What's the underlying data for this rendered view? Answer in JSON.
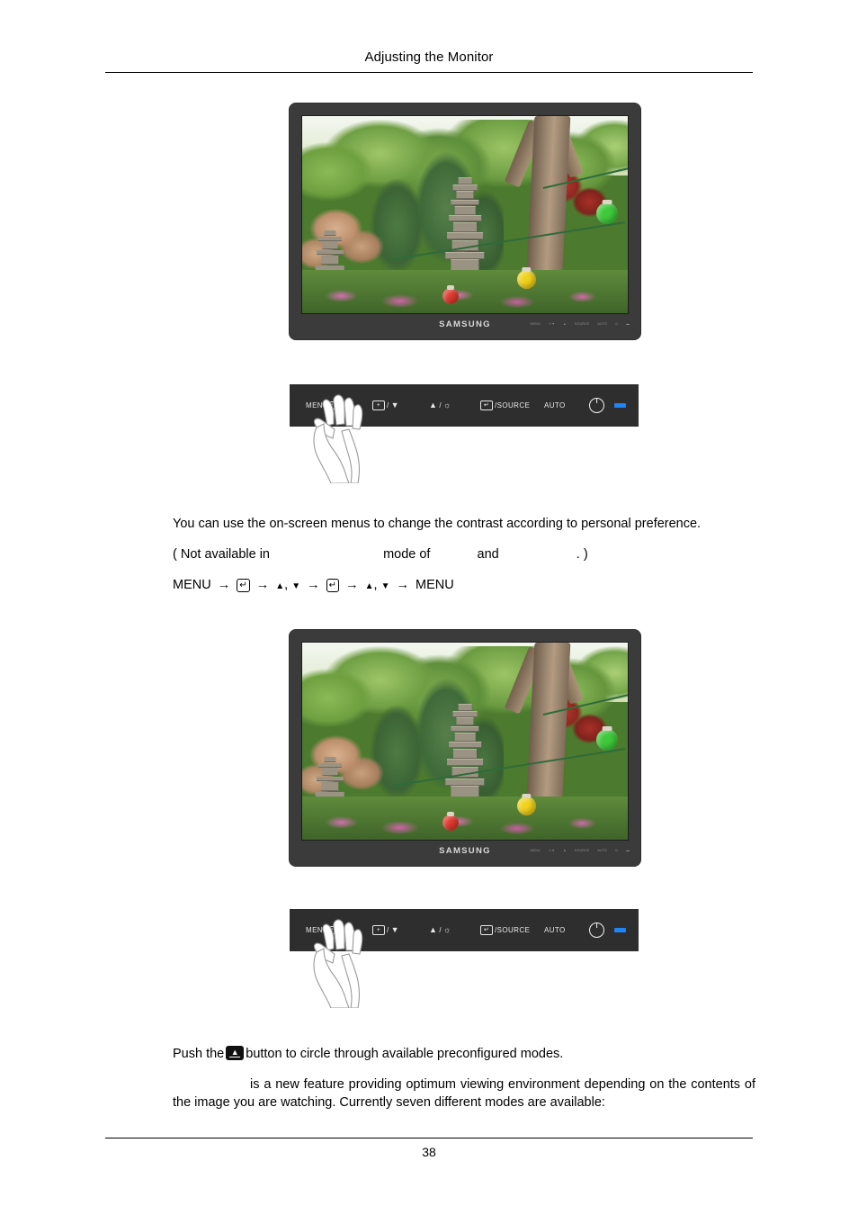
{
  "document": {
    "header_title": "Adjusting the Monitor",
    "page_number": "38"
  },
  "monitor_top": {
    "brand_logo": "SAMSUNG",
    "bezel_mini_labels": [
      "MENU",
      "+/▼",
      "▲",
      "SOURCE",
      "AUTO",
      "⏻",
      "▬"
    ],
    "screen_description": "Korean garden with stone pagodas, pine trees, azaleas and colored paper lanterns"
  },
  "control_panel_top": {
    "buttons": [
      {
        "name": "menu",
        "label": "MENU",
        "icon": "menu-bars-icon"
      },
      {
        "name": "minus-down",
        "label": "/",
        "left_icon": "plus-box-icon",
        "right_icon": "triangle-down-icon"
      },
      {
        "name": "up-brightness",
        "label": "/",
        "left_icon": "triangle-up-icon",
        "right_icon": "sun-brightness-icon"
      },
      {
        "name": "enter-source",
        "label": "/SOURCE",
        "left_icon": "enter-box-icon"
      },
      {
        "name": "auto",
        "label": "AUTO"
      },
      {
        "name": "power",
        "label": "",
        "icon": "power-icon"
      },
      {
        "name": "led",
        "label": "",
        "icon": "power-led-indicator",
        "color": "#1f84f5"
      }
    ],
    "hand_pointer": "hand-pressing-menu-button"
  },
  "section_contrast": {
    "paragraph_1": "You can use the on-screen menus to change the contrast according to personal preference.",
    "note_prefix": "( Not available in",
    "note_mid": "mode of",
    "note_and": "and",
    "note_suffix": ". )",
    "nav_start": "MENU",
    "nav_end": "MENU",
    "nav_enter_symbol": "↵",
    "nav_arrow": "→",
    "nav_up": "▲",
    "nav_down": "▼",
    "nav_comma": ","
  },
  "monitor_bottom": {
    "brand_logo": "SAMSUNG",
    "bezel_mini_labels": [
      "MENU",
      "+/▼",
      "▲",
      "SOURCE",
      "AUTO",
      "⏻",
      "▬"
    ],
    "screen_description": "Korean garden with stone pagodas, pine trees, azaleas and colored paper lanterns"
  },
  "control_panel_bottom": {
    "buttons": [
      {
        "name": "menu",
        "label": "MENU",
        "icon": "menu-bars-icon"
      },
      {
        "name": "minus-down",
        "label": "/",
        "left_icon": "plus-box-icon",
        "right_icon": "triangle-down-icon"
      },
      {
        "name": "up-brightness",
        "label": "/",
        "left_icon": "triangle-up-icon",
        "right_icon": "sun-brightness-icon"
      },
      {
        "name": "enter-source",
        "label": "/SOURCE",
        "left_icon": "enter-box-icon"
      },
      {
        "name": "auto",
        "label": "AUTO"
      },
      {
        "name": "power",
        "label": "",
        "icon": "power-icon"
      },
      {
        "name": "led",
        "label": "",
        "icon": "power-led-indicator",
        "color": "#1f84f5"
      }
    ],
    "hand_pointer": "hand-pressing-menu-button"
  },
  "section_magicbright": {
    "push_prefix": "Push the",
    "push_suffix": "button to circle through available preconfigured modes.",
    "paragraph_2": "is a new feature providing optimum viewing environment depending on the contents of the image you are watching. Currently seven different modes are available:"
  },
  "labels": {
    "menu_text": "MENU",
    "source_text": "/SOURCE",
    "auto_text": "AUTO",
    "slash": "/",
    "plus": "+",
    "enter": "↵",
    "triangle_up": "▲",
    "triangle_down": "▼",
    "sun": "☼"
  },
  "colors": {
    "bezel": "#3b3b3b",
    "panel": "#2e2e2e",
    "led_blue": "#1f84f5",
    "text": "#000000"
  }
}
